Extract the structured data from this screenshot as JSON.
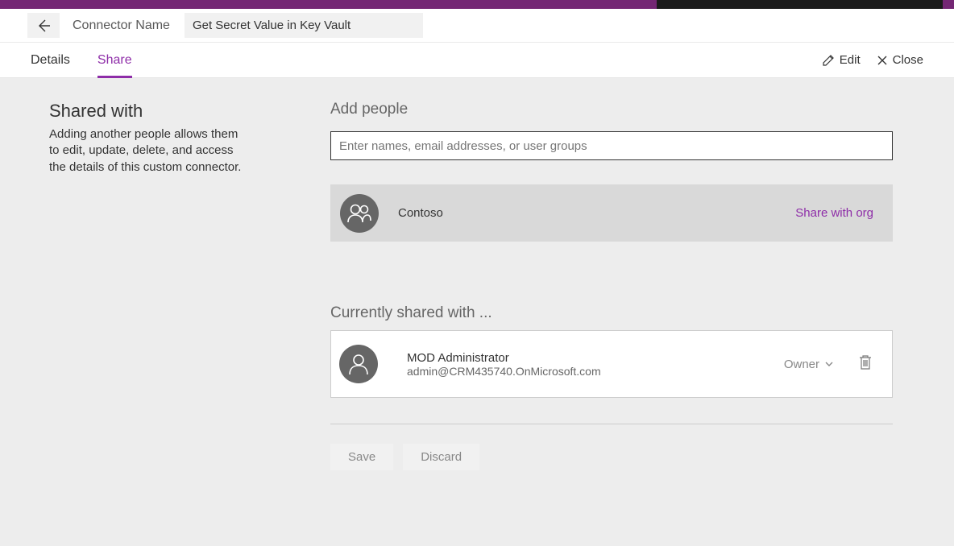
{
  "header": {
    "label": "Connector Name",
    "value": "Get Secret Value in Key Vault"
  },
  "tabs": {
    "details": "Details",
    "share": "Share"
  },
  "actions": {
    "edit": "Edit",
    "close": "Close"
  },
  "sidebar": {
    "title": "Shared with",
    "description": "Adding another people allows them to edit, update, delete, and access the details of this custom connector."
  },
  "addPeople": {
    "label": "Add people",
    "placeholder": "Enter names, email addresses, or user groups"
  },
  "suggestion": {
    "name": "Contoso",
    "action": "Share with org"
  },
  "currently": {
    "label": "Currently shared with ..."
  },
  "sharedUser": {
    "name": "MOD Administrator",
    "email": "admin@CRM435740.OnMicrosoft.com",
    "role": "Owner"
  },
  "buttons": {
    "save": "Save",
    "discard": "Discard"
  }
}
